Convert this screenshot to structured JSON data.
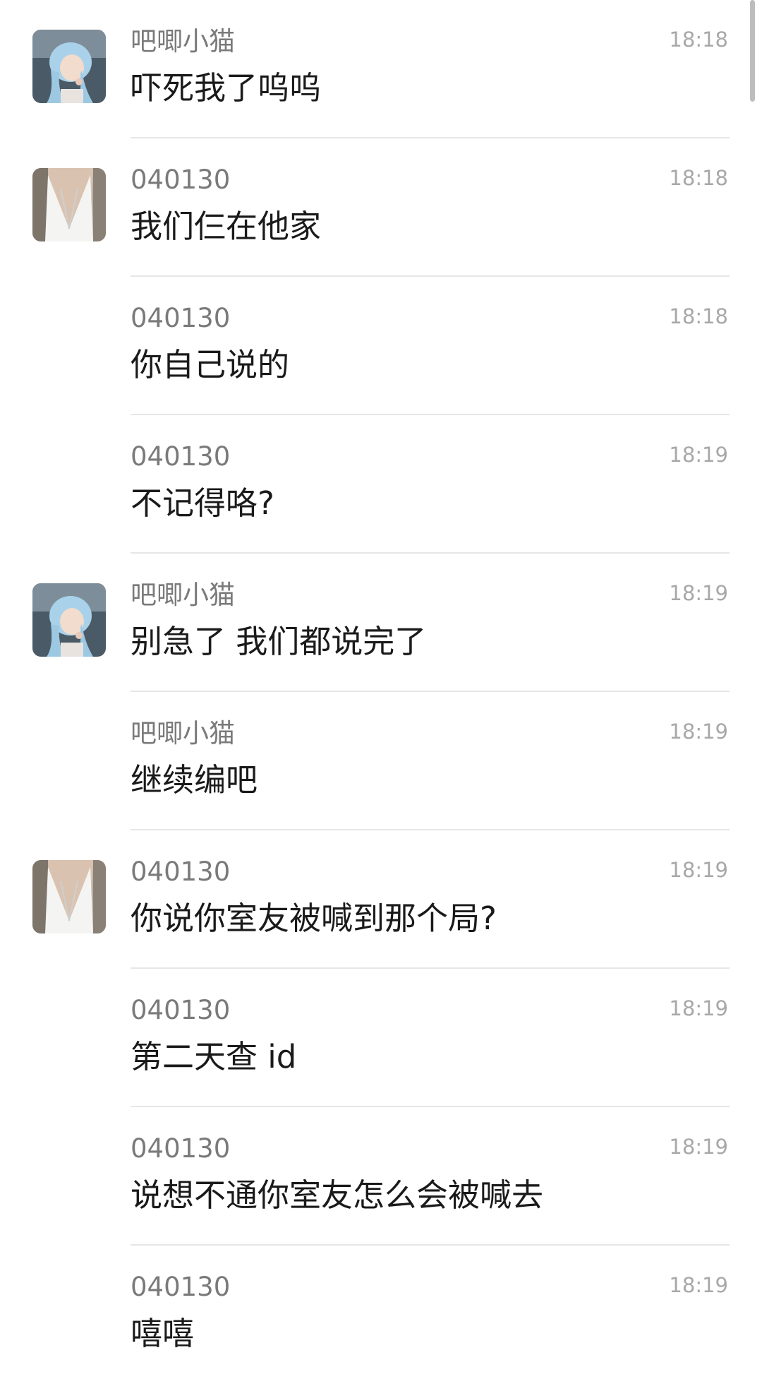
{
  "messages": [
    {
      "sender": "吧唧小猫",
      "text": "吓死我了呜呜",
      "time": "18:18",
      "avatar": "avatar-blue-hair-icon"
    },
    {
      "sender": "040130",
      "text": "我们仨在他家",
      "time": "18:18",
      "avatar": "avatar-white-dress-icon"
    },
    {
      "sender": "040130",
      "text": "你自己说的",
      "time": "18:18",
      "avatar": ""
    },
    {
      "sender": "040130",
      "text": "不记得咯?",
      "time": "18:19",
      "avatar": ""
    },
    {
      "sender": "吧唧小猫",
      "text": "别急了 我们都说完了",
      "time": "18:19",
      "avatar": "avatar-blue-hair-icon"
    },
    {
      "sender": "吧唧小猫",
      "text": "继续编吧",
      "time": "18:19",
      "avatar": ""
    },
    {
      "sender": "040130",
      "text": "你说你室友被喊到那个局?",
      "time": "18:19",
      "avatar": "avatar-white-dress-icon"
    },
    {
      "sender": "040130",
      "text": "第二天查 id",
      "time": "18:19",
      "avatar": ""
    },
    {
      "sender": "040130",
      "text": "说想不通你室友怎么会被喊去",
      "time": "18:19",
      "avatar": ""
    },
    {
      "sender": "040130",
      "text": "嘻嘻",
      "time": "18:19",
      "avatar": ""
    }
  ],
  "colors": {
    "background": "#ffffff",
    "sender": "#7a7a7a",
    "message": "#1a1a1a",
    "time": "#a8a8a8",
    "divider": "#e6e6e6"
  }
}
